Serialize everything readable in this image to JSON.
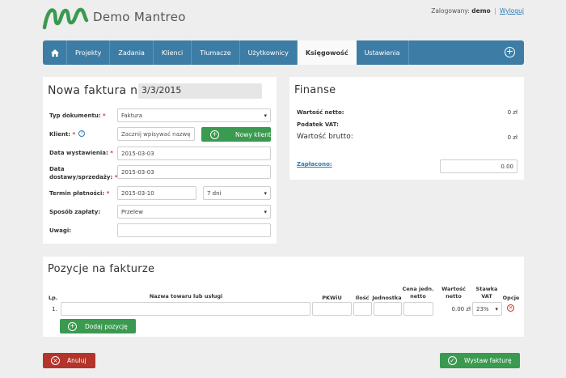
{
  "header": {
    "app_name": "Demo Mantreo",
    "logged_in_label": "Zalogowany:",
    "username": "demo",
    "separator": "|",
    "logout_label": "Wyloguj"
  },
  "nav": {
    "items": [
      {
        "label": "Projekty"
      },
      {
        "label": "Zadania"
      },
      {
        "label": "Klienci"
      },
      {
        "label": "Tłumacze"
      },
      {
        "label": "Użytkownicy"
      },
      {
        "label": "Księgowość",
        "active": true
      },
      {
        "label": "Ustawienia"
      }
    ]
  },
  "invoice": {
    "title": "Nowa faktura nr",
    "number": "3/3/2015",
    "doc_type_label": "Typ dokumentu:",
    "doc_type_value": "Faktura",
    "client_label": "Klient:",
    "client_placeholder": "Zacznij wpisywać nazwę kli",
    "new_client_label": "Nowy klient",
    "issue_date_label": "Data wystawienia:",
    "issue_date_value": "2015-03-03",
    "delivery_date_label_1": "Data",
    "delivery_date_label_2": "dostawy/sprzedaży:",
    "delivery_date_value": "2015-03-03",
    "payment_term_label": "Termin płatności:",
    "payment_term_date": "2015-03-10",
    "payment_term_days": "7 dni",
    "payment_method_label": "Sposób zapłaty:",
    "payment_method_value": "Przelew",
    "notes_label": "Uwagi:",
    "notes_value": "",
    "required_mark": "*"
  },
  "finance": {
    "title": "Finanse",
    "net_label": "Wartość netto:",
    "net_value": "0 zł",
    "vat_label": "Podatek VAT:",
    "gross_label": "Wartość brutto:",
    "gross_value": "0 zł",
    "paid_label": "Zapłacono:",
    "paid_value": "0.00"
  },
  "positions": {
    "title": "Pozycje na fakturze",
    "columns": {
      "lp": "Lp.",
      "name": "Nazwa towaru lub usługi",
      "pkwiu": "PKWiU",
      "qty": "Ilość",
      "unit": "Jednostka",
      "unit_price_1": "Cena jedn.",
      "unit_price_2": "netto",
      "net_value_1": "Wartość",
      "net_value_2": "netto",
      "vat_1": "Stawka",
      "vat_2": "VAT",
      "options": "Opcje"
    },
    "rows": [
      {
        "lp": "1.",
        "name": "",
        "pkwiu": "",
        "qty": "",
        "unit": "",
        "unit_price": "",
        "net_value": "0.00 zł",
        "vat": "23%"
      }
    ],
    "add_label": "Dodaj pozycję"
  },
  "footer": {
    "cancel_label": "Anuluj",
    "issue_label": "Wystaw fakturę"
  },
  "colors": {
    "nav_bg": "#3d7da5",
    "green": "#3a9a4f",
    "red": "#b3342b",
    "link": "#2b7ab3"
  }
}
